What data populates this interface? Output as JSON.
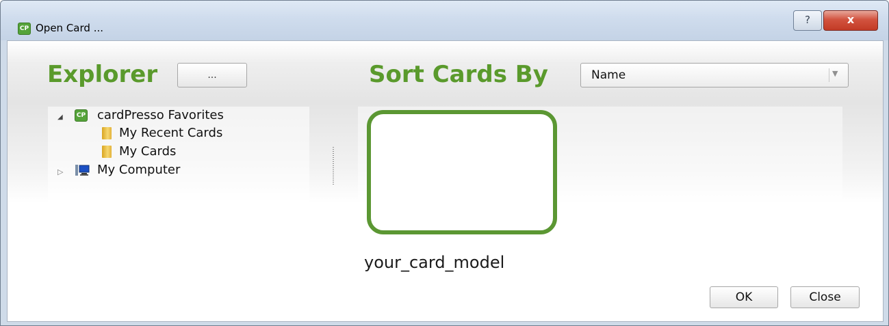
{
  "window": {
    "title": "Open Card ...",
    "help_label": "?",
    "close_label": "x",
    "app_icon_text": "CP"
  },
  "explorer": {
    "label": "Explorer",
    "browse_label": "...",
    "tree": [
      {
        "label": "cardPresso Favorites",
        "icon": "cardpresso-icon",
        "expanded": true
      },
      {
        "label": "My Recent Cards",
        "icon": "folder-icon"
      },
      {
        "label": "My Cards",
        "icon": "folder-icon"
      },
      {
        "label": "My Computer",
        "icon": "computer-icon",
        "expanded": false
      }
    ]
  },
  "sort": {
    "label": "Sort Cards By",
    "selected": "Name"
  },
  "cards": [
    {
      "name": "your_card_model"
    }
  ],
  "buttons": {
    "ok": "OK",
    "close": "Close"
  },
  "colors": {
    "accent_green": "#5a9a2c",
    "card_border": "#5b9733",
    "close_red": "#c94330"
  }
}
